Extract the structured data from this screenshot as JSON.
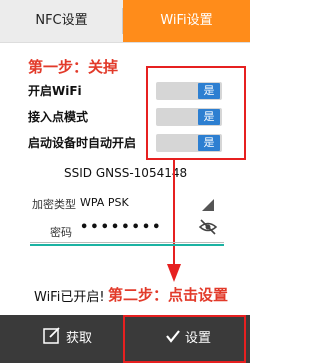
{
  "tabs": {
    "nfc_label": "NFC设置",
    "wifi_label": "WiFi设置"
  },
  "annotations": {
    "step1": "第一步：关掉",
    "step2": "第二步：点击设置"
  },
  "settings": {
    "rows": [
      {
        "label": "开启WiFi",
        "value": "是"
      },
      {
        "label": "接入点模式",
        "value": "是"
      },
      {
        "label": "启动设备时自动开启",
        "value": "是"
      }
    ],
    "ssid": "SSID GNSS-1054148",
    "encryption_label": "加密类型",
    "encryption_value": "WPA PSK",
    "password_label": "密码",
    "password_value": "••••••••"
  },
  "status": {
    "text": "WiFi已开启!"
  },
  "bottom_bar": {
    "get_label": "获取",
    "set_label": "设置"
  },
  "colors": {
    "accent_orange": "#ff8c1a",
    "toggle_blue": "#2d7fd1",
    "annotation_red": "#e23a2a",
    "teal": "#1bb3a3"
  }
}
